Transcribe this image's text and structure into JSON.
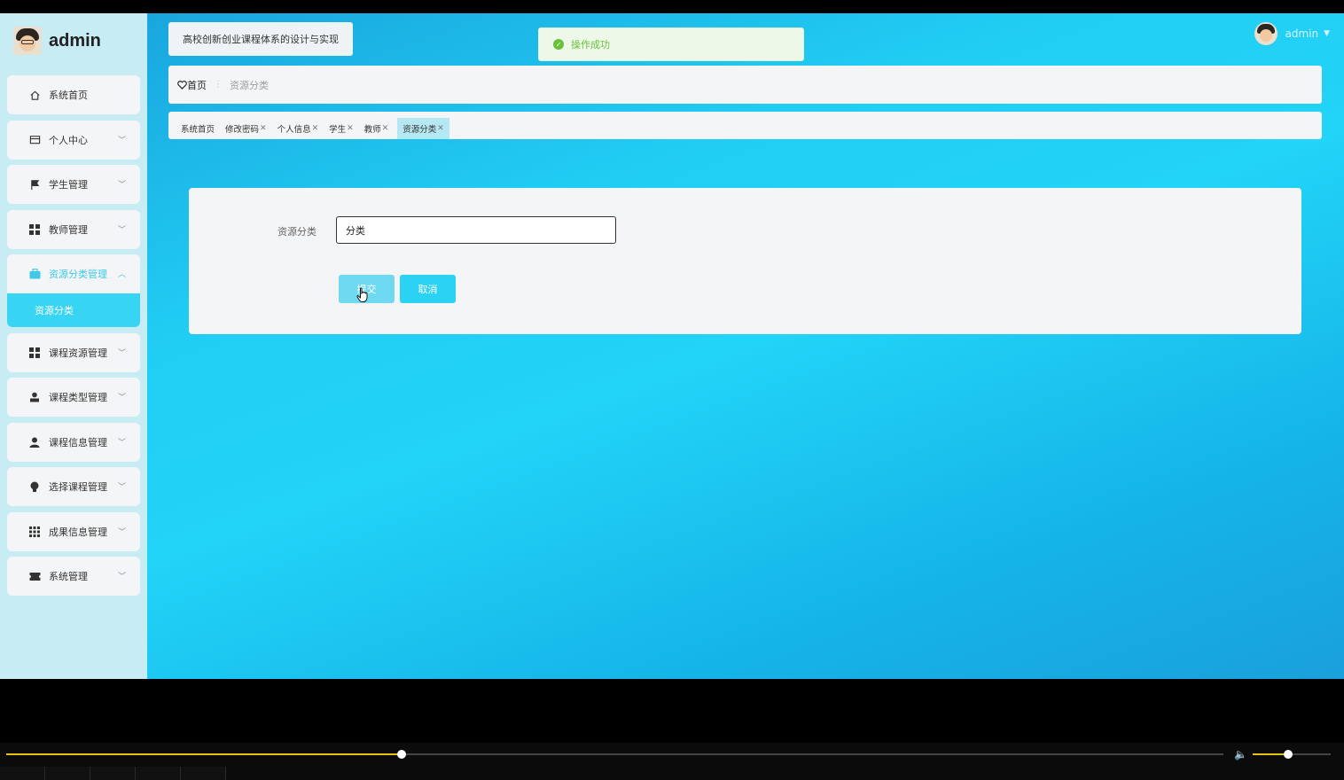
{
  "brand": {
    "name": "admin"
  },
  "sidebar": {
    "items": [
      {
        "label": "系统首页",
        "icon": "home-icon"
      },
      {
        "label": "个人中心",
        "icon": "card-icon"
      },
      {
        "label": "学生管理",
        "icon": "flag-icon"
      },
      {
        "label": "教师管理",
        "icon": "grid-icon"
      },
      {
        "label": "资源分类管理",
        "icon": "briefcase-icon",
        "active": true,
        "children": [
          {
            "label": "资源分类"
          }
        ]
      },
      {
        "label": "课程资源管理",
        "icon": "grid-icon"
      },
      {
        "label": "课程类型管理",
        "icon": "user-icon"
      },
      {
        "label": "课程信息管理",
        "icon": "person-icon"
      },
      {
        "label": "选择课程管理",
        "icon": "bulb-icon"
      },
      {
        "label": "成果信息管理",
        "icon": "apps-icon"
      },
      {
        "label": "系统管理",
        "icon": "ticket-icon"
      }
    ]
  },
  "header": {
    "title": "高校创新创业课程体系的设计与实现",
    "toast": "操作成功",
    "user": "admin"
  },
  "breadcrumb": {
    "home": "首页",
    "current": "资源分类"
  },
  "tags": [
    {
      "label": "系统首页",
      "closable": false
    },
    {
      "label": "修改密码",
      "closable": true
    },
    {
      "label": "个人信息",
      "closable": true
    },
    {
      "label": "学生",
      "closable": true
    },
    {
      "label": "教师",
      "closable": true
    },
    {
      "label": "资源分类",
      "closable": true,
      "active": true
    }
  ],
  "form": {
    "label": "资源分类",
    "value": "分类",
    "submit": "提交",
    "cancel": "取消"
  },
  "player": {
    "progress": 0.325,
    "volume": 0.45
  },
  "colors": {
    "accent": "#22d4f7",
    "sidebar_bg": "#c8ecf4",
    "success": "#67c23a"
  }
}
